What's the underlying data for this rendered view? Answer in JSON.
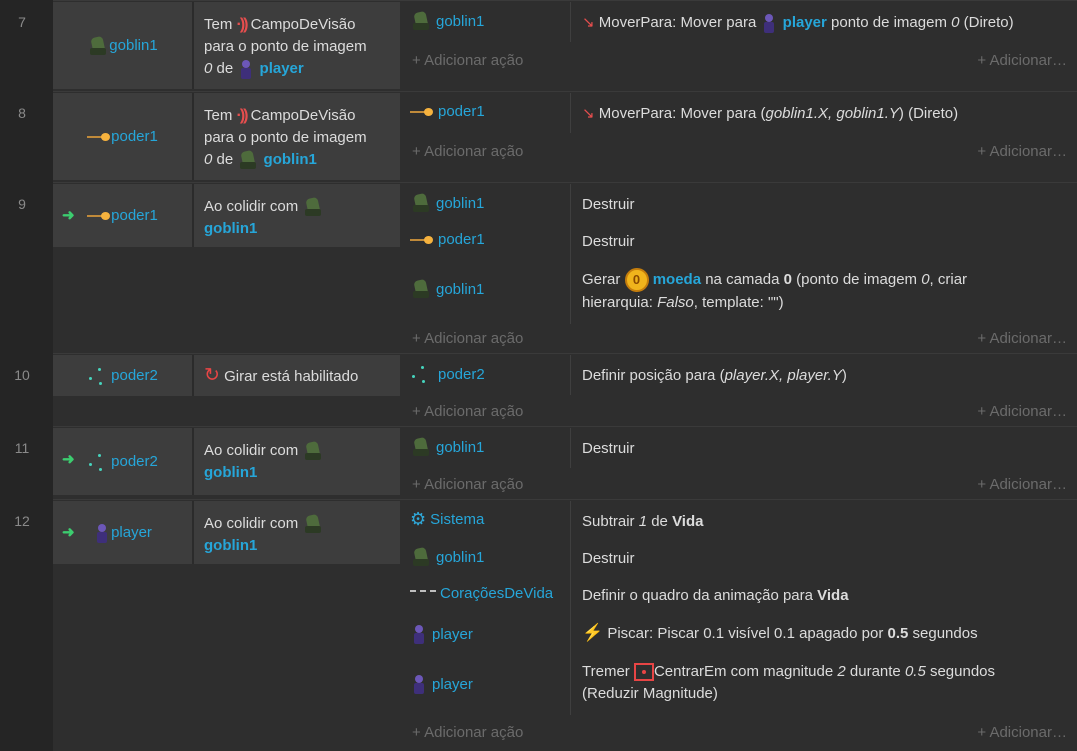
{
  "common": {
    "add_action": "Adicionar ação",
    "add_condition_trunc": "Adicionar…"
  },
  "rows": [
    {
      "number": "7",
      "condition": {
        "object": "goblin1",
        "p1": "Tem",
        "sensor": "CampoDeVisão",
        "p2": "para o ponto de imagem",
        "p3_num": "0",
        "p3_de": "de",
        "p3_obj": "player"
      },
      "actions": [
        {
          "object": "goblin1",
          "verb": "MoverPara: Mover para",
          "target": "player",
          "rest": "ponto de imagem",
          "num": "0",
          "end": "(Direto)"
        }
      ]
    },
    {
      "number": "8",
      "condition": {
        "object": "poder1",
        "p1": "Tem",
        "sensor": "CampoDeVisão",
        "p2": "para o ponto de imagem",
        "p3_num": "0",
        "p3_de": "de",
        "p3_obj": "goblin1"
      },
      "actions": [
        {
          "object": "poder1",
          "verb": "MoverPara: Mover para (",
          "args": "goblin1.X, goblin1.Y",
          "end": ") (Direto)"
        }
      ]
    },
    {
      "number": "9",
      "condition": {
        "object": "poder1",
        "text": "Ao colidir com",
        "target": "goblin1"
      },
      "actions": [
        {
          "object": "goblin1",
          "text": "Destruir"
        },
        {
          "object": "poder1",
          "text": "Destruir"
        },
        {
          "object": "goblin1",
          "gerar": "Gerar",
          "coin_obj": "moeda",
          "camada": "na camada",
          "layer": "0",
          "ponto": "(ponto de imagem",
          "ponto_num": "0",
          "hier": ", criar",
          "hier2": "hierarquia:",
          "falso": "Falso",
          "templ": ", template: \"\")"
        }
      ]
    },
    {
      "number": "10",
      "condition": {
        "object": "poder2",
        "text": "Girar está habilitado"
      },
      "actions": [
        {
          "object": "poder2",
          "prefix": "Definir posição para (",
          "args": "player.X, player.Y",
          "end": ")"
        }
      ]
    },
    {
      "number": "11",
      "condition": {
        "object": "poder2",
        "text": "Ao colidir com",
        "target": "goblin1"
      },
      "actions": [
        {
          "object": "goblin1",
          "text": "Destruir"
        }
      ]
    },
    {
      "number": "12",
      "condition": {
        "object": "player",
        "text": "Ao colidir com",
        "target": "goblin1"
      },
      "actions": [
        {
          "object": "Sistema",
          "subtrair": "Subtrair",
          "num": "1",
          "de": "de",
          "var": "Vida"
        },
        {
          "object": "goblin1",
          "text": "Destruir"
        },
        {
          "object": "CoraçõesDeVida",
          "prefix": "Definir o quadro da animação para",
          "var": "Vida"
        },
        {
          "object": "player",
          "piscar": "Piscar: Piscar 0.1 visível 0.1 apagado por",
          "dur": "0.5",
          "seg": "segundos"
        },
        {
          "object": "player",
          "tremer": "Tremer",
          "centrar": "CentrarEm com magnitude",
          "mag": "2",
          "durante": "durante",
          "dur": "0.5",
          "seg": "segundos",
          "reduzir": "(Reduzir Magnitude)"
        }
      ]
    }
  ]
}
